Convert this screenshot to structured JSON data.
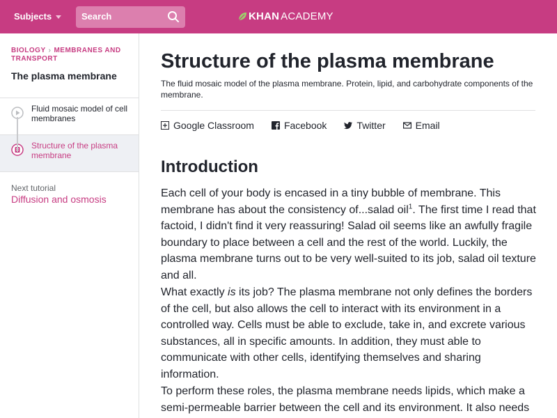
{
  "header": {
    "subjects_label": "Subjects",
    "search_placeholder": "Search",
    "logo_khan": "KHAN",
    "logo_academy": "ACADEMY",
    "brand_color": "#c73c82"
  },
  "sidebar": {
    "breadcrumb": [
      "Biology",
      "Membranes and transport"
    ],
    "tutorial_title": "The plasma membrane",
    "items": [
      {
        "label": "Fluid mosaic model of cell membranes",
        "icon": "play-icon",
        "active": false
      },
      {
        "label": "Structure of the plasma membrane",
        "icon": "article-icon",
        "active": true
      }
    ],
    "next_label": "Next tutorial",
    "next_link": "Diffusion and osmosis"
  },
  "article": {
    "title": "Structure of the plasma membrane",
    "description": "The fluid mosaic model of the plasma membrane. Protein, lipid, and carbohydrate components of the membrane.",
    "share": {
      "google_classroom": "Google Classroom",
      "facebook": "Facebook",
      "twitter": "Twitter",
      "email": "Email"
    },
    "section_title": "Introduction",
    "p1_a": "Each cell of your body is encased in a tiny bubble of membrane. This membrane has about the consistency of...salad oil",
    "p1_sup": "1",
    "p1_b": ". The first time I read that factoid, I didn't find it very reassuring! Salad oil seems like an awfully fragile boundary to place between a cell and the rest of the world. Luckily, the plasma membrane turns out to be very well-suited to its job, salad oil texture and all.",
    "p2_a": "What exactly ",
    "p2_em": "is",
    "p2_b": " its job? The plasma membrane not only defines the borders of the cell, but also allows the cell to interact with its environment in a controlled way. Cells must be able to exclude, take in, and excrete various substances, all in specific amounts. In addition, they must able to communicate with other cells, identifying themselves and sharing information.",
    "p3": "To perform these roles, the plasma membrane needs lipids, which make a semi-permeable barrier between the cell and its environment. It also needs proteins,"
  }
}
